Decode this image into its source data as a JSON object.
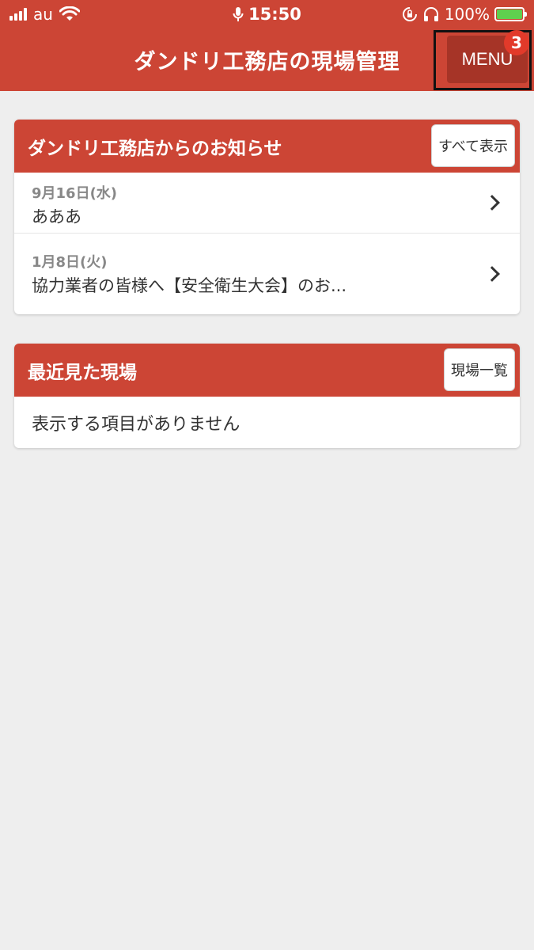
{
  "status_bar": {
    "carrier": "au",
    "time": "15:50",
    "battery": "100%"
  },
  "header": {
    "title": "ダンドリ工務店の現場管理",
    "menu_label": "MENU",
    "menu_badge": "3"
  },
  "notices": {
    "title": "ダンドリ工務店からのお知らせ",
    "show_all_label": "すべて表示",
    "items": [
      {
        "date": "9月16日(水)",
        "text": "あああ"
      },
      {
        "date": "1月8日(火)",
        "text": "協力業者の皆様へ【安全衛生大会】のお..."
      }
    ]
  },
  "recent_sites": {
    "title": "最近見た現場",
    "list_label": "現場一覧",
    "empty_text": "表示する項目がありません"
  },
  "colors": {
    "brand": "#cc4535",
    "menu_button": "#a63427",
    "badge": "#e23a2a",
    "background": "#eeeeee"
  }
}
